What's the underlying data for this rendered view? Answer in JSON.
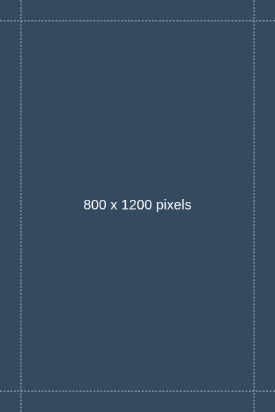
{
  "placeholder": {
    "label": "800 x 1200 pixels",
    "background_color": "#344a61",
    "text_color": "#ffffff",
    "guide_color": "#f2f4f7"
  }
}
